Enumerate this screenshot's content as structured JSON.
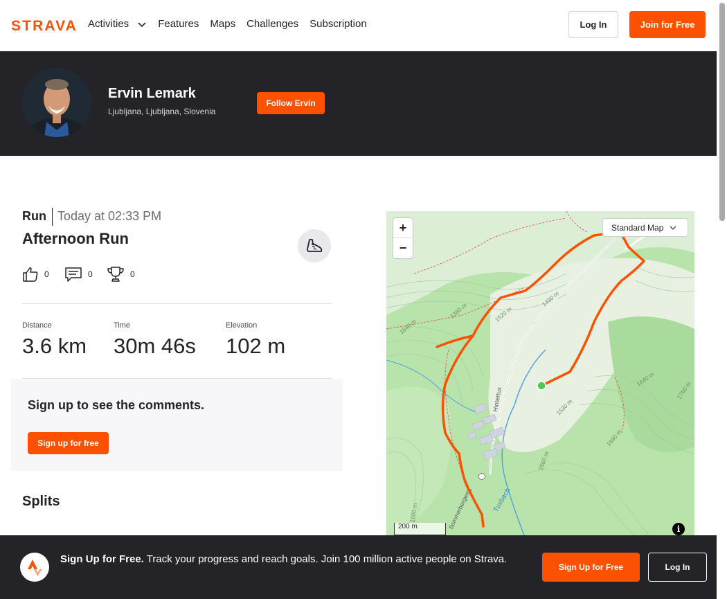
{
  "brand": {
    "logo_text": "STRAVA",
    "accent": "#fc5200",
    "dark": "#242428"
  },
  "nav": {
    "items": [
      "Activities",
      "Features",
      "Maps",
      "Challenges",
      "Subscription"
    ],
    "login_label": "Log In",
    "join_label": "Join for Free"
  },
  "athlete": {
    "name": "Ervin Lemark",
    "location": "Ljubljana, Ljubljana, Slovenia",
    "follow_label": "Follow Ervin"
  },
  "activity": {
    "type": "Run",
    "time": "Today at 02:33 PM",
    "title": "Afternoon Run",
    "kudos": "0",
    "comments": "0",
    "achievements": "0",
    "stats": [
      {
        "label": "Distance",
        "value": "3.6 km"
      },
      {
        "label": "Time",
        "value": "30m 46s"
      },
      {
        "label": "Elevation",
        "value": "102 m"
      }
    ]
  },
  "comments": {
    "title": "Sign up to see the comments.",
    "button_label": "Sign up for free"
  },
  "splits": {
    "title": "Splits"
  },
  "map": {
    "style_label": "Standard Map",
    "zoom_in": "+",
    "zoom_out": "−",
    "scale_label": "200 m",
    "info_label": "i",
    "labels": [
      "1380 m",
      "1520 m",
      "1490 m",
      "1640 m",
      "Hintertux",
      "1560 m",
      "1690 m",
      "1640 m",
      "1760 m",
      "1530 m",
      "1600 m",
      "Tuxbach",
      "Sommerbergweg"
    ]
  },
  "banner": {
    "headline": "Sign Up for Free.",
    "text": "Track your progress and reach goals. Join 100 million active people on Strava.",
    "signup_label": "Sign Up for Free",
    "login_label": "Log In"
  }
}
